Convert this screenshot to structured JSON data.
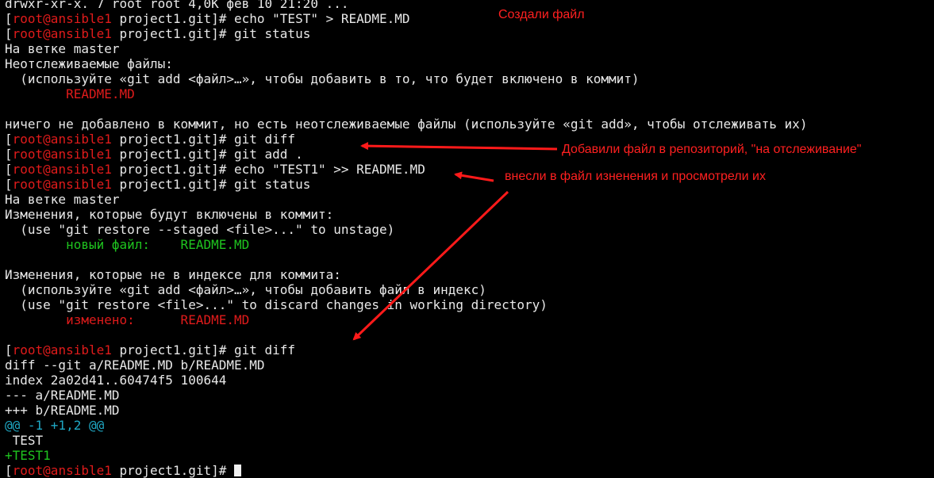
{
  "terminal": {
    "lines": [
      {
        "segments": [
          {
            "t": "drwxr-xr-x. 7 root root 4,0K фев 10 21:20 ...",
            "c": ""
          }
        ]
      },
      {
        "segments": [
          {
            "t": "[",
            "c": ""
          },
          {
            "t": "root@ansible1",
            "c": "red"
          },
          {
            "t": " project1.git]# echo \"TEST\" > README.MD",
            "c": ""
          }
        ]
      },
      {
        "segments": [
          {
            "t": "[",
            "c": ""
          },
          {
            "t": "root@ansible1",
            "c": "red"
          },
          {
            "t": " project1.git]# git status",
            "c": ""
          }
        ]
      },
      {
        "segments": [
          {
            "t": "На ветке master",
            "c": ""
          }
        ]
      },
      {
        "segments": [
          {
            "t": "Неотслеживаемые файлы:",
            "c": ""
          }
        ]
      },
      {
        "segments": [
          {
            "t": "  (используйте «git add <файл>…», чтобы добавить в то, что будет включено в коммит)",
            "c": ""
          }
        ]
      },
      {
        "segments": [
          {
            "t": "        README.MD",
            "c": "red"
          }
        ]
      },
      {
        "segments": [
          {
            "t": "",
            "c": ""
          }
        ]
      },
      {
        "segments": [
          {
            "t": "ничего не добавлено в коммит, но есть неотслеживаемые файлы (используйте «git add», чтобы отслеживать их)",
            "c": ""
          }
        ]
      },
      {
        "segments": [
          {
            "t": "[",
            "c": ""
          },
          {
            "t": "root@ansible1",
            "c": "red"
          },
          {
            "t": " project1.git]# git diff",
            "c": ""
          }
        ]
      },
      {
        "segments": [
          {
            "t": "[",
            "c": ""
          },
          {
            "t": "root@ansible1",
            "c": "red"
          },
          {
            "t": " project1.git]# git add .",
            "c": ""
          }
        ]
      },
      {
        "segments": [
          {
            "t": "[",
            "c": ""
          },
          {
            "t": "root@ansible1",
            "c": "red"
          },
          {
            "t": " project1.git]# echo \"TEST1\" >> README.MD",
            "c": ""
          }
        ]
      },
      {
        "segments": [
          {
            "t": "[",
            "c": ""
          },
          {
            "t": "root@ansible1",
            "c": "red"
          },
          {
            "t": " project1.git]# git status",
            "c": ""
          }
        ]
      },
      {
        "segments": [
          {
            "t": "На ветке master",
            "c": ""
          }
        ]
      },
      {
        "segments": [
          {
            "t": "Изменения, которые будут включены в коммит:",
            "c": ""
          }
        ]
      },
      {
        "segments": [
          {
            "t": "  (use \"git restore --staged <file>...\" to unstage)",
            "c": ""
          }
        ]
      },
      {
        "segments": [
          {
            "t": "        новый файл:    README.MD",
            "c": "green"
          }
        ]
      },
      {
        "segments": [
          {
            "t": "",
            "c": ""
          }
        ]
      },
      {
        "segments": [
          {
            "t": "Изменения, которые не в индексе для коммита:",
            "c": ""
          }
        ]
      },
      {
        "segments": [
          {
            "t": "  (используйте «git add <файл>…», чтобы добавить файл в индекс)",
            "c": ""
          }
        ]
      },
      {
        "segments": [
          {
            "t": "  (use \"git restore <file>...\" to discard changes in working directory)",
            "c": ""
          }
        ]
      },
      {
        "segments": [
          {
            "t": "        изменено:      README.MD",
            "c": "red"
          }
        ]
      },
      {
        "segments": [
          {
            "t": "",
            "c": ""
          }
        ]
      },
      {
        "segments": [
          {
            "t": "[",
            "c": ""
          },
          {
            "t": "root@ansible1",
            "c": "red"
          },
          {
            "t": " project1.git]# git diff",
            "c": ""
          }
        ]
      },
      {
        "segments": [
          {
            "t": "diff --git a/README.MD b/README.MD",
            "c": ""
          }
        ]
      },
      {
        "segments": [
          {
            "t": "index 2a02d41..60474f5 100644",
            "c": ""
          }
        ]
      },
      {
        "segments": [
          {
            "t": "--- a/README.MD",
            "c": ""
          }
        ]
      },
      {
        "segments": [
          {
            "t": "+++ b/README.MD",
            "c": ""
          }
        ]
      },
      {
        "segments": [
          {
            "t": "@@ -1 +1,2 @@",
            "c": "cyan"
          }
        ]
      },
      {
        "segments": [
          {
            "t": " TEST",
            "c": ""
          }
        ]
      },
      {
        "segments": [
          {
            "t": "+TEST1",
            "c": "green"
          }
        ]
      },
      {
        "segments": [
          {
            "t": "[",
            "c": ""
          },
          {
            "t": "root@ansible1",
            "c": "red"
          },
          {
            "t": " project1.git]# ",
            "c": ""
          }
        ],
        "cursor": true
      }
    ]
  },
  "annotations": {
    "created_file": "Создали файл",
    "added_to_repo": "Добавили файл в репозиторий, \"на отслеживание\"",
    "modified_and_viewed": "внесли в файл изненения и просмотрели их"
  },
  "colors": {
    "prompt_user": "#e01b1b",
    "new_file": "#1fc41f",
    "hunk_header": "#1fa8c4",
    "annotation": "#ff2020"
  }
}
